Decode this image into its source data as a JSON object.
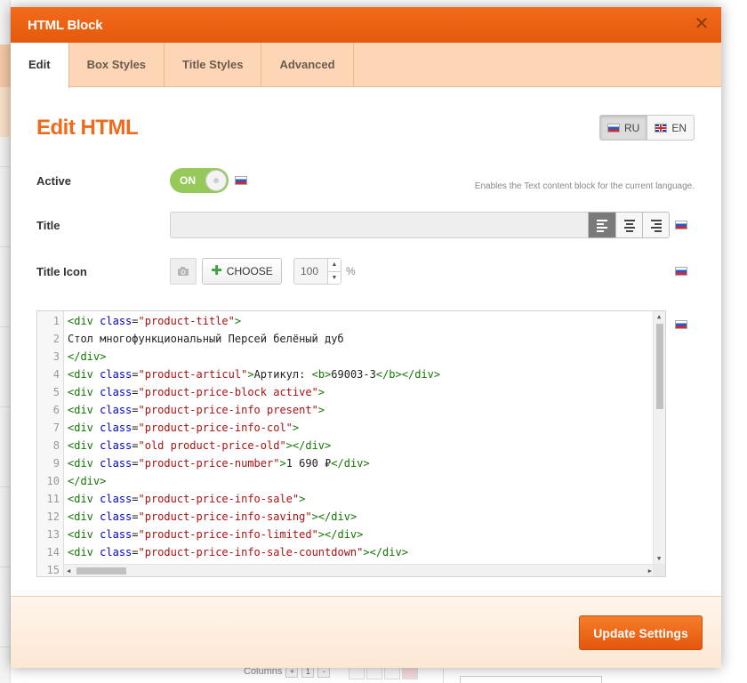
{
  "modal": {
    "title": "HTML Block",
    "close_symbol": "✕"
  },
  "tabs": [
    {
      "label": "Edit",
      "active": true
    },
    {
      "label": "Box Styles",
      "active": false
    },
    {
      "label": "Title Styles",
      "active": false
    },
    {
      "label": "Advanced",
      "active": false
    }
  ],
  "content": {
    "heading": "Edit HTML",
    "languages": [
      {
        "code": "RU",
        "flag": "flag-ru-icon",
        "active": true
      },
      {
        "code": "EN",
        "flag": "flag-en-icon",
        "active": false
      }
    ],
    "active": {
      "label": "Active",
      "toggle_text": "ON",
      "enabled": true,
      "hint": "Enables the Text content block for the current language."
    },
    "title": {
      "label": "Title",
      "value": "",
      "alignment": "left",
      "align_options": [
        "left",
        "center",
        "right"
      ]
    },
    "title_icon": {
      "label": "Title Icon",
      "choose_label": "CHOOSE",
      "size_value": "100",
      "unit": "%"
    }
  },
  "code": {
    "lines": [
      "<div class=\"product-title\">",
      "Стол многофункциональный Персей белёный дуб",
      "</div>",
      "<div class=\"product-articul\">Артикул: <b>69003-3</b></div>",
      "<div class=\"product-price-block active\">",
      "<div class=\"product-price-info present\">",
      "<div class=\"product-price-info-col\">",
      "<div class=\"old product-price-old\"></div>",
      "<div class=\"product-price-number\">1 690 ₽</div>",
      "</div>",
      "<div class=\"product-price-info-sale\">",
      "<div class=\"product-price-info-saving\"></div>",
      "<div class=\"product-price-info-limited\"></div>",
      "<div class=\"product-price-info-sale-countdown\"></div>",
      ""
    ]
  },
  "footer": {
    "update_label": "Update Settings"
  },
  "background": {
    "columns_label": "Columns",
    "columns_value": "1"
  },
  "colors": {
    "accent": "#ef6a1a",
    "header": "#e55a0c",
    "tab_bar": "#fdd7b5",
    "toggle_on": "#95c95a"
  }
}
